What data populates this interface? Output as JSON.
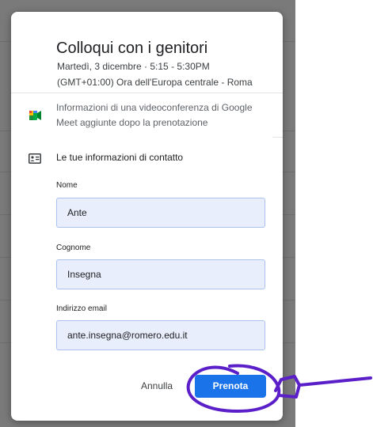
{
  "dialog": {
    "title": "Colloqui con i genitori",
    "date_line": "Martedì, 3 dicembre · 5:15 - 5:30PM",
    "timezone_line": "(GMT+01:00) Ora dell'Europa centrale - Roma",
    "meet_info": "Informazioni di una videoconferenza di Google Meet aggiunte dopo la prenotazione",
    "contact_section_title": "Le tue informazioni di contatto",
    "fields": {
      "first_name": {
        "label": "Nome",
        "value": "Ante"
      },
      "last_name": {
        "label": "Cognome",
        "value": "Insegna"
      },
      "email": {
        "label": "Indirizzo email",
        "value": "ante.insegna@romero.edu.it"
      }
    },
    "cancel_label": "Annulla",
    "book_label": "Prenota"
  },
  "colors": {
    "primary": "#1a73e8",
    "field_bg": "#e8eefb",
    "annotation": "#5b1fc9"
  },
  "icons": {
    "meet": "google-meet-icon",
    "contact": "contact-card-icon"
  }
}
